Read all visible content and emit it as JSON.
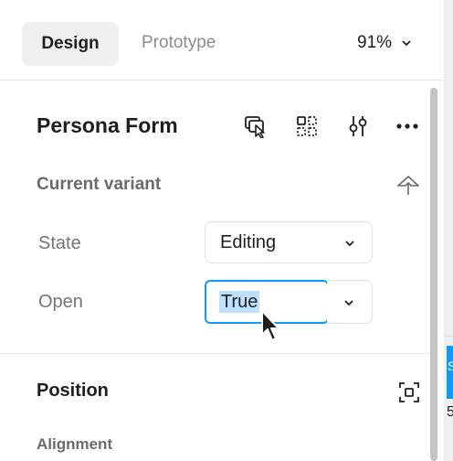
{
  "tabs": {
    "design_label": "Design",
    "prototype_label": "Prototype",
    "zoom_label": "91%"
  },
  "component": {
    "title": "Persona Form",
    "icons": [
      "select-matching-layers-icon",
      "component-grid-icon",
      "adjust-sliders-icon",
      "more-options-icon"
    ]
  },
  "variant": {
    "section_label": "Current variant",
    "properties": [
      {
        "label": "State",
        "value": "Editing"
      },
      {
        "label": "Open",
        "value": "True"
      }
    ]
  },
  "position": {
    "title": "Position",
    "alignment_label": "Alignment"
  },
  "external": {
    "chip_text": "S",
    "number_text": "5"
  },
  "colors": {
    "accent": "#0d99ff",
    "selection": "#bde0ff",
    "muted_text": "#757575",
    "tab_bg": "#f0f0f0"
  }
}
